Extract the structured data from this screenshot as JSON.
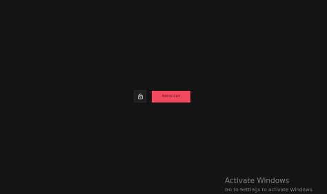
{
  "product": {
    "cart_icon": "shopping-bag-icon",
    "add_to_cart_label": "Add to Cart",
    "button_color": "#f2495e"
  },
  "watermark": {
    "title": "Activate Windows",
    "subtitle": "Go to Settings to activate Windows."
  },
  "colors": {
    "background": "#141414",
    "icon_box": "#1f1f1f",
    "watermark_text": "#7f7f7f"
  }
}
